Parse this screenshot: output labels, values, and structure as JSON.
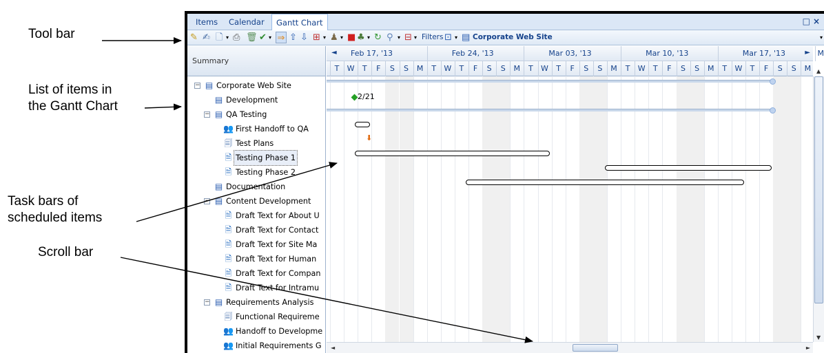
{
  "annotations": {
    "toolbar": "Tool bar",
    "items_list_line1": "List of items in",
    "items_list_line2": "the Gantt Chart",
    "taskbars_line1": "Task bars of",
    "taskbars_line2": "scheduled items",
    "scrollbar": "Scroll bar"
  },
  "tabs": [
    "Items",
    "Calendar",
    "Gantt Chart"
  ],
  "active_tab": "Gantt Chart",
  "window_controls": {
    "restore": "□",
    "close": "×"
  },
  "toolbar": {
    "filters_label": "Filters",
    "site_label": "Corporate Web Site",
    "icons": [
      "pencil-icon",
      "edit-icon",
      "new-item-icon",
      "print-icon",
      "delete-icon",
      "check-icon",
      "export-icon",
      "move-up-icon",
      "move-down-icon",
      "grid-icon",
      "assign-icon",
      "stop-icon",
      "users-icon",
      "refresh-icon",
      "link-icon",
      "columns-icon",
      "filter-icon",
      "site-icon"
    ]
  },
  "summary": {
    "header": "Summary",
    "items": [
      {
        "label": "Corporate Web Site",
        "level": 0,
        "icon": "summary-task-icon",
        "expander": "−"
      },
      {
        "label": "Development",
        "level": 1,
        "icon": "summary-task-icon"
      },
      {
        "label": "QA Testing",
        "level": 1,
        "icon": "summary-task-icon",
        "expander": "−"
      },
      {
        "label": "First Handoff to QA",
        "level": 2,
        "icon": "people-icon"
      },
      {
        "label": "Test Plans",
        "level": 2,
        "icon": "document-stack-icon"
      },
      {
        "label": "Testing Phase 1",
        "level": 2,
        "icon": "document-icon",
        "selected": true
      },
      {
        "label": "Testing Phase 2",
        "level": 2,
        "icon": "document-icon"
      },
      {
        "label": "Documentation",
        "level": 1,
        "icon": "summary-task-icon"
      },
      {
        "label": "Content Development",
        "level": 1,
        "icon": "summary-task-icon",
        "expander": "−"
      },
      {
        "label": "Draft Text for About U",
        "level": 2,
        "icon": "document-icon"
      },
      {
        "label": "Draft Text for Contact",
        "level": 2,
        "icon": "document-icon"
      },
      {
        "label": "Draft Text for Site Ma",
        "level": 2,
        "icon": "document-icon"
      },
      {
        "label": "Draft Text for Human",
        "level": 2,
        "icon": "document-icon"
      },
      {
        "label": "Draft Text for Compan",
        "level": 2,
        "icon": "document-icon"
      },
      {
        "label": "Draft Text for Intramu",
        "level": 2,
        "icon": "document-icon"
      },
      {
        "label": "Requirements Analysis",
        "level": 1,
        "icon": "summary-task-icon",
        "expander": "−"
      },
      {
        "label": "Functional Requireme",
        "level": 2,
        "icon": "document-stack-icon"
      },
      {
        "label": "Handoff to Developme",
        "level": 2,
        "icon": "people-icon"
      },
      {
        "label": "Initial Requirements G",
        "level": 2,
        "icon": "people-icon"
      }
    ]
  },
  "gantt": {
    "weeks": [
      "Feb 17, '13",
      "Feb 24, '13",
      "Mar 03, '13",
      "Mar 10, '13",
      "Mar 17, '13",
      "Mar"
    ],
    "days": [
      "T",
      "W",
      "T",
      "F",
      "S",
      "S",
      "M",
      "T",
      "W",
      "T",
      "F",
      "S",
      "S",
      "M",
      "T",
      "W",
      "T",
      "F",
      "S",
      "S",
      "M",
      "T",
      "W",
      "T",
      "F",
      "S",
      "S",
      "M",
      "T",
      "W",
      "T",
      "F",
      "S",
      "S",
      "M"
    ],
    "milestone_label": "2/21",
    "prev_arrow": "◄",
    "next_arrow": "►"
  }
}
